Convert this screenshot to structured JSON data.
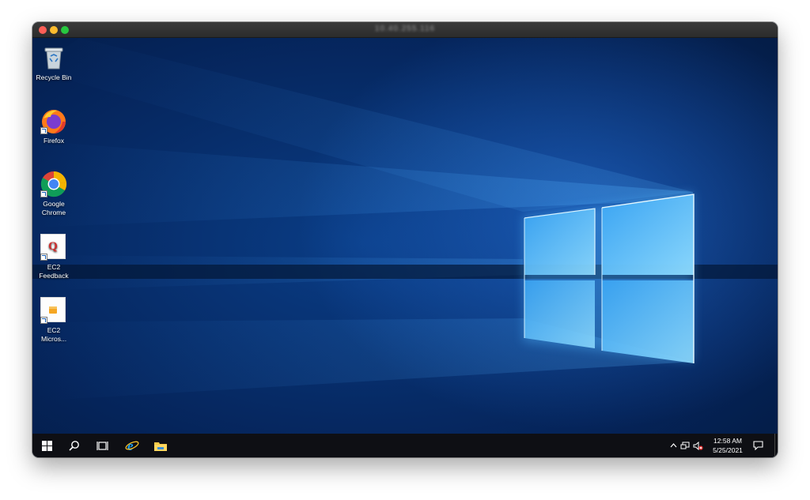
{
  "window": {
    "title": "10.40.255.116",
    "controls": [
      "close",
      "minimize",
      "zoom"
    ]
  },
  "desktop": {
    "icons": [
      {
        "id": "recycle-bin",
        "label_line1": "Recycle Bin",
        "label_line2": "",
        "icon": "recycle-bin-icon",
        "shortcut": false
      },
      {
        "id": "firefox",
        "label_line1": "Firefox",
        "label_line2": "",
        "icon": "firefox-icon",
        "shortcut": true
      },
      {
        "id": "google-chrome",
        "label_line1": "Google",
        "label_line2": "Chrome",
        "icon": "chrome-icon",
        "shortcut": true
      },
      {
        "id": "ec2-feedback",
        "label_line1": "EC2",
        "label_line2": "Feedback",
        "icon": "ec2-feedback-icon",
        "shortcut": true
      },
      {
        "id": "ec2-micros",
        "label_line1": "EC2",
        "label_line2": "Micros...",
        "icon": "ec2-microsoft-icon",
        "shortcut": true
      }
    ]
  },
  "taskbar": {
    "items": [
      {
        "id": "start",
        "icon": "windows-start-icon"
      },
      {
        "id": "search",
        "icon": "search-icon"
      },
      {
        "id": "task-view",
        "icon": "task-view-icon"
      },
      {
        "id": "internet-explorer",
        "icon": "internet-explorer-icon"
      },
      {
        "id": "file-explorer",
        "icon": "file-explorer-icon"
      }
    ],
    "tray": {
      "icons": [
        "chevron-up-icon",
        "network-icon",
        "volume-muted-icon"
      ],
      "time": "12:58 AM",
      "date": "5/25/2021",
      "notification_icon": "action-center-icon"
    }
  },
  "colors": {
    "taskbar": "#0e0f14",
    "wallpaper_dark": "#031533",
    "wallpaper_light": "#6fd0ff",
    "close": "#fe5f57",
    "minimize": "#febc2e",
    "zoom": "#28c840"
  }
}
